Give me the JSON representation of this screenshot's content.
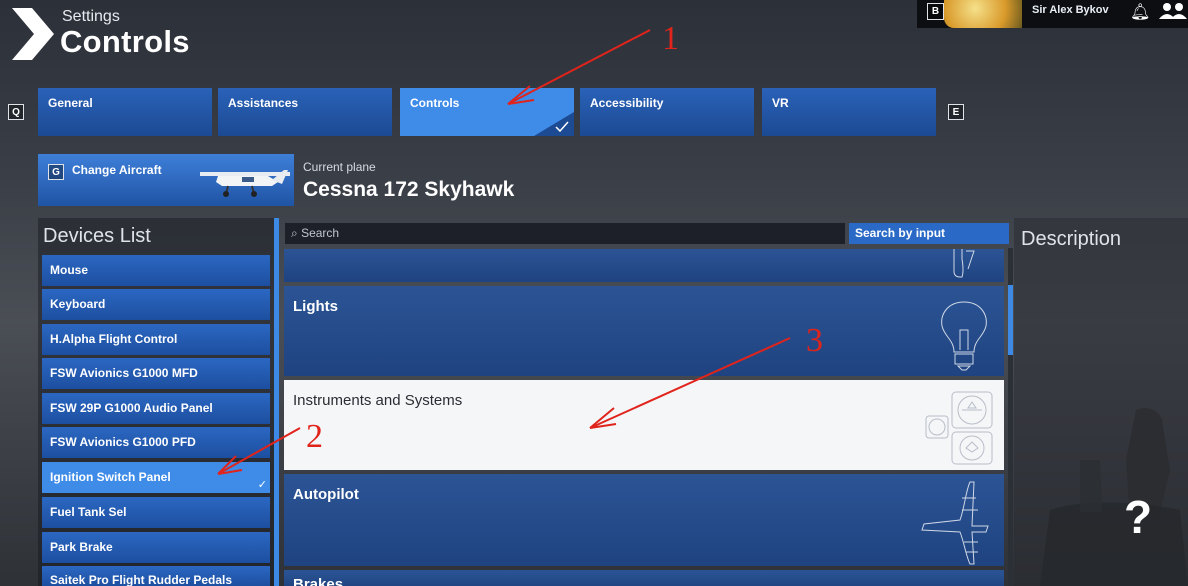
{
  "header": {
    "breadcrumb": "Settings",
    "title": "Controls",
    "key_b": "B",
    "user_name": "Sir Alex Bykov"
  },
  "tabs": {
    "prev_key": "Q",
    "next_key": "E",
    "items": [
      {
        "label": "General"
      },
      {
        "label": "Assistances"
      },
      {
        "label": "Controls",
        "active": true
      },
      {
        "label": "Accessibility"
      },
      {
        "label": "VR"
      }
    ]
  },
  "aircraft": {
    "key": "G",
    "button_label": "Change Aircraft",
    "current_label": "Current plane",
    "current_value": "Cessna 172 Skyhawk"
  },
  "devices": {
    "title": "Devices List",
    "items": [
      {
        "label": "Mouse"
      },
      {
        "label": "Keyboard"
      },
      {
        "label": "H.Alpha Flight Control"
      },
      {
        "label": "FSW Avionics G1000 MFD"
      },
      {
        "label": "FSW 29P G1000 Audio Panel"
      },
      {
        "label": "FSW Avionics G1000 PFD"
      },
      {
        "label": "Ignition Switch Panel",
        "selected": true
      },
      {
        "label": "Fuel Tank Sel"
      },
      {
        "label": "Park Brake"
      },
      {
        "label": "Saitek Pro Flight Rudder Pedals"
      }
    ]
  },
  "search": {
    "placeholder": "Search",
    "by_input_label": "Search by input"
  },
  "categories": [
    {
      "label": ""
    },
    {
      "label": "Lights"
    },
    {
      "label": "Instruments and Systems",
      "highlighted": true
    },
    {
      "label": "Autopilot"
    },
    {
      "label": "Brakes"
    }
  ],
  "description": {
    "title": "Description",
    "help_glyph": "?"
  },
  "annotations": [
    "1",
    "2",
    "3"
  ],
  "colors": {
    "accent": "#3f8ce8",
    "tab_blue": "#1c4a93",
    "annotation_red": "#e0241c"
  }
}
